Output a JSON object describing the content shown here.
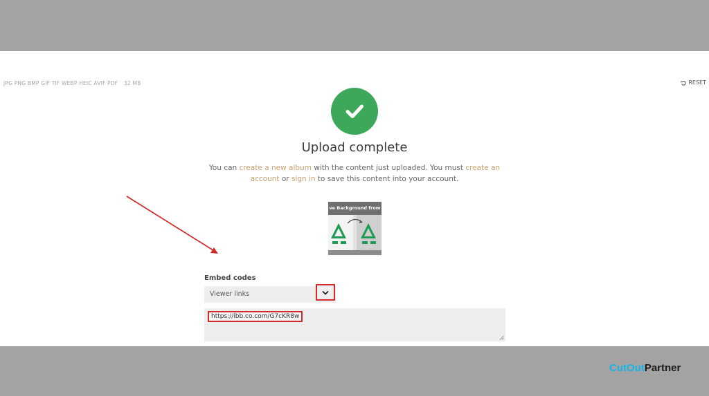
{
  "upload": {
    "formats": "JPG PNG BMP GIF TIF WEBP HEIC AVIF PDF",
    "max_size": "32 MB",
    "reset_label": "RESET",
    "title": "Upload complete",
    "message": {
      "p1": "You can ",
      "link_album": "create a new album",
      "p2": " with the content just uploaded. You must ",
      "link_create": "create an account",
      "p3": " or ",
      "link_signin": "sign in",
      "p4": " to save this content into your account."
    },
    "thumbnail_caption": "ve Background from"
  },
  "embed": {
    "label": "Embed codes",
    "selected_option": "Viewer links",
    "code_value": "https://ibb.co.com/G7cKR8w"
  },
  "watermark": {
    "part1": "Cut",
    "part2": "Out",
    "part3": "Partner"
  },
  "colors": {
    "success": "#3ea85a",
    "link": "#c9a06e",
    "highlight": "#d12a2a",
    "brand_blue": "#13b4e6"
  },
  "icons": [
    "check-icon",
    "reset-icon",
    "chevron-down-icon",
    "resize-handle-icon",
    "arrow-annotation"
  ]
}
